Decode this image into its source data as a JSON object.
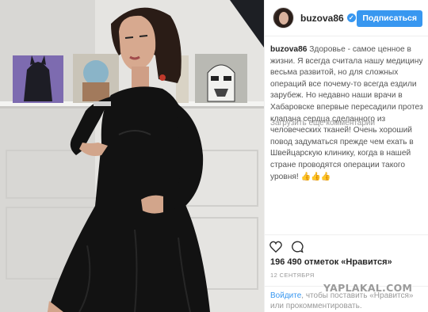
{
  "post": {
    "username": "buzova86",
    "verified_mark": "✓",
    "follow_label": "Подписаться",
    "caption": "Здоровье - самое ценное в жизни. Я всегда считала нашу медицину весьма развитой, но для сложных операций все почему-то всегда ездили зарубеж. Но недавно наши врачи в Хабаровске впервые пересадили протез клапана сердца сделанного из человеческих тканей! Очень хороший повод задуматься прежде чем ехать в Швейцарскую клинику, когда в нашей стране проводятся операции такого уровня! ",
    "caption_tail": "👍👍👍",
    "load_more": "Загрузить еще комментарии",
    "likes": "196 490 отметок «Нравится»",
    "date": "12 СЕНТЯБРЯ",
    "login_link": "Войдите",
    "login_text": ", чтобы поставить «Нравится» или прокомментировать."
  },
  "icons": {
    "like": "heart-outline-icon",
    "comment": "comment-bubble-icon"
  },
  "watermark": "YAPLAKAL.COM",
  "colors": {
    "accent": "#3897f0",
    "text": "#262626",
    "muted": "#999999",
    "border": "#efefef",
    "dress": "#111111"
  }
}
